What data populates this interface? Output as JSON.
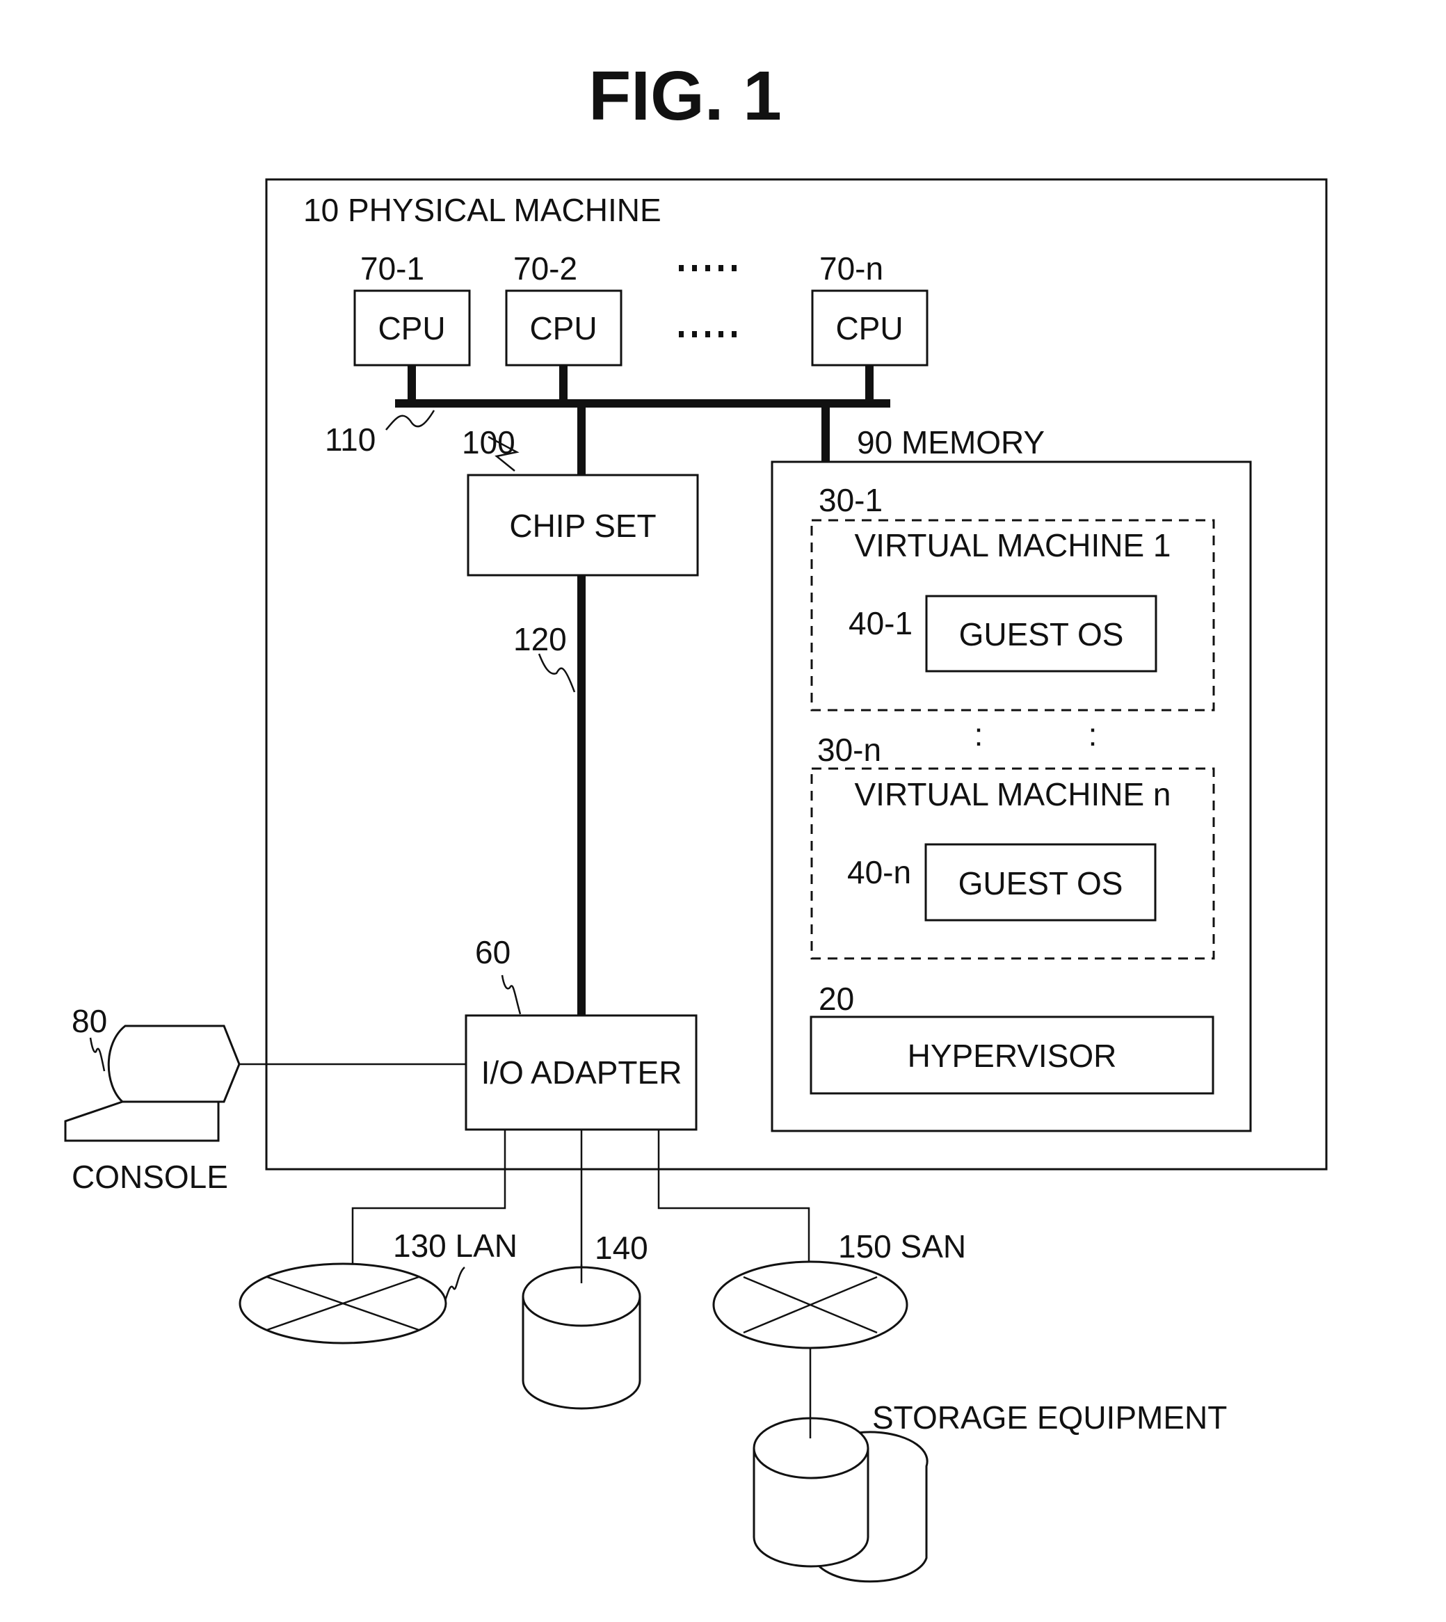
{
  "figure": {
    "title": "FIG. 1"
  },
  "physical_machine": {
    "label": "10 PHYSICAL MACHINE"
  },
  "cpus": [
    {
      "ref": "70-1",
      "label": "CPU"
    },
    {
      "ref": "70-2",
      "label": "CPU"
    },
    {
      "ref": "70-n",
      "label": "CPU"
    }
  ],
  "ellipsis": {
    "dots": "·····"
  },
  "buses": {
    "cpu_bus_ref": "110",
    "chipset_ref": "100",
    "io_bus_ref": "120"
  },
  "chipset": {
    "label": "CHIP SET"
  },
  "memory": {
    "label": "90 MEMORY",
    "vm1": {
      "ref": "30-1",
      "label": "VIRTUAL MACHINE 1",
      "os_ref": "40-1",
      "os_label": "GUEST OS"
    },
    "vm_ellipsis": ":",
    "vmn": {
      "ref": "30-n",
      "label": "VIRTUAL MACHINE n",
      "os_ref": "40-n",
      "os_label": "GUEST OS"
    },
    "hypervisor": {
      "ref": "20",
      "label": "HYPERVISOR"
    }
  },
  "io_adapter": {
    "ref": "60",
    "label": "I/O ADAPTER"
  },
  "console": {
    "ref": "80",
    "label": "CONSOLE"
  },
  "network": {
    "lan_label": "130 LAN",
    "disk_label": "140",
    "san_label": "150 SAN",
    "storage_label": "STORAGE EQUIPMENT"
  }
}
